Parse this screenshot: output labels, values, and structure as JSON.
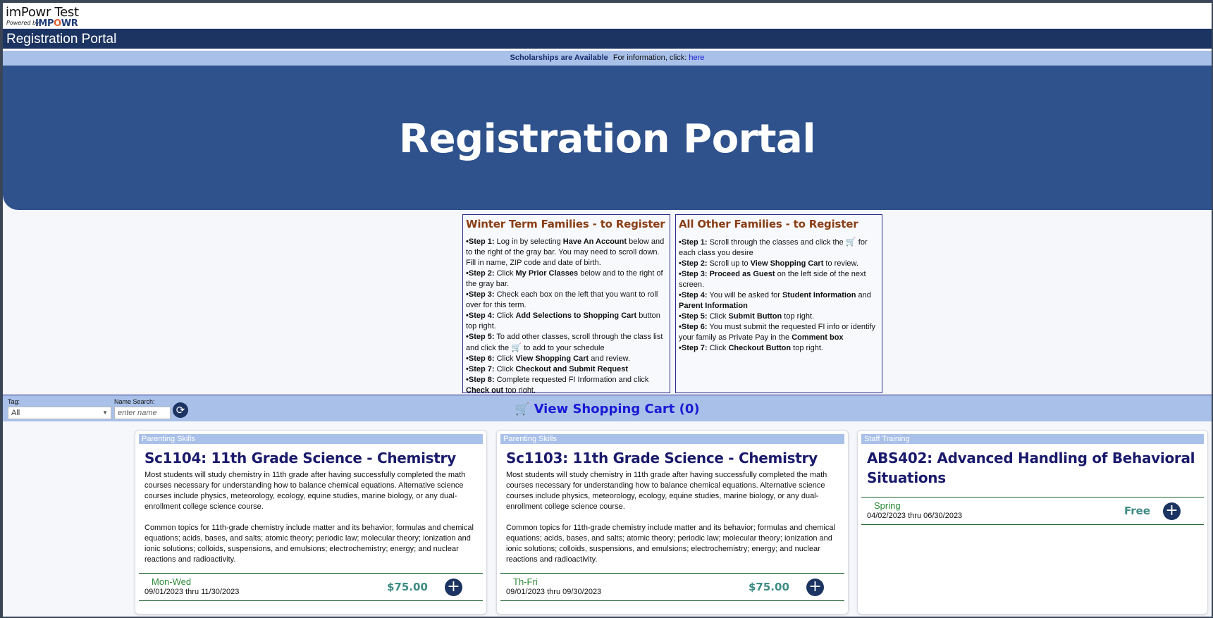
{
  "header": {
    "app_title": "imPowr Test",
    "powered_by": "Powered by",
    "brand_pre": "IMP",
    "brand_o": "O",
    "brand_post": "WR"
  },
  "portal_bar": {
    "title": "Registration Portal"
  },
  "notice": {
    "bold": "Scholarships are Available",
    "text": "For information, click:",
    "link": "here"
  },
  "hero": {
    "title": "Registration Portal"
  },
  "winter": {
    "title": "Winter Term Families - to Register",
    "steps": [
      {
        "label": "•Step 1:",
        "pre": " Log in by selecting ",
        "bold": "Have An Account",
        "post": " below and to the right of the gray bar. You may need to scroll down. Fill in name, ZIP code and date of birth."
      },
      {
        "label": "•Step 2:",
        "pre": " Click ",
        "bold": "My Prior Classes",
        "post": " below and to the right of the gray bar."
      },
      {
        "label": "•Step 3:",
        "pre": " Check each box on the left that you want to roll over for this term.",
        "bold": "",
        "post": ""
      },
      {
        "label": "•Step 4:",
        "pre": " Click ",
        "bold": "Add Selections to Shopping Cart",
        "post": " button top right."
      },
      {
        "label": "•Step 5:",
        "pre": " To add other classes, scroll through the class list and click the ",
        "bold": "",
        "post": " to add to your schedule"
      },
      {
        "label": "•Step 6:",
        "pre": " Click ",
        "bold": "View Shopping Cart",
        "post": " and review."
      },
      {
        "label": "•Step 7:",
        "pre": " Click ",
        "bold": "Checkout and Submit Request",
        "post": ""
      },
      {
        "label": "•Step 8:",
        "pre": " Complete requested FI Information and click ",
        "bold": "Check out",
        "post": " top right."
      }
    ]
  },
  "other": {
    "title": "All Other Families - to Register",
    "steps": [
      {
        "label": "•Step 1:",
        "pre": " Scroll through the classes and click the ",
        "bold": "",
        "post": " for each class you desire"
      },
      {
        "label": "•Step 2:",
        "pre": " Scroll up to ",
        "bold": "View Shopping Cart",
        "post": " to review."
      },
      {
        "label": "•Step 3:",
        "pre": " ",
        "bold": "Proceed as Guest",
        "post": " on the left side of the next screen."
      },
      {
        "label": "•Step 4:",
        "pre": " You will be asked for ",
        "bold": "Student Information",
        "post": " and "
      },
      {
        "label": "•Step 5:",
        "pre": " Click ",
        "bold": "Submit Button",
        "post": " top right."
      },
      {
        "label": "•Step 6:",
        "pre": " You must submit the requested FI info or identify your family as Private Pay in the ",
        "bold": "Comment box",
        "post": ""
      },
      {
        "label": "•Step 7:",
        "pre": " Click ",
        "bold": "Checkout Button",
        "post": " top right."
      }
    ],
    "step4_bold2": "Parent Information"
  },
  "filters": {
    "tag_label": "Tag:",
    "tag_value": "All",
    "name_label": "Name Search:",
    "name_placeholder": "enter name"
  },
  "cart": {
    "label": "View Shopping Cart (0)"
  },
  "courses": [
    {
      "category": "Parenting Skills",
      "title": "Sc1104: 11th Grade Science - Chemistry",
      "desc1": "Most students will study chemistry in 11th grade after having successfully completed the math courses necessary for understanding how to balance chemical equations. Alternative science courses include physics, meteorology, ecology, equine studies, marine biology, or any dual-enrollment college science course.",
      "desc2": "Common topics for 11th-grade chemistry include matter and its behavior; formulas and chemical equations; acids, bases, and salts; atomic theory; periodic law; molecular theory; ionization and ionic solutions; colloids, suspensions, and emulsions; electrochemistry; energy; and nuclear reactions and radioactivity.",
      "day": "Mon-Wed",
      "dates": "09/01/2023 thru 11/30/2023",
      "price": "$75.00"
    },
    {
      "category": "Parenting Skills",
      "title": "Sc1103: 11th Grade Science - Chemistry",
      "desc1": "Most students will study chemistry in 11th grade after having successfully completed the math courses necessary for understanding how to balance chemical equations. Alternative science courses include physics, meteorology, ecology, equine studies, marine biology, or any dual-enrollment college science course.",
      "desc2": "Common topics for 11th-grade chemistry include matter and its behavior; formulas and chemical equations; acids, bases, and salts; atomic theory; periodic law; molecular theory; ionization and ionic solutions; colloids, suspensions, and emulsions; electrochemistry; energy; and nuclear reactions and radioactivity.",
      "day": "Th-Fri",
      "dates": "09/01/2023 thru 09/30/2023",
      "price": "$75.00"
    },
    {
      "category": "Staff Training",
      "title": "ABS402: Advanced Handling of Behavioral Situations",
      "desc1": "",
      "desc2": "",
      "day": "Spring",
      "dates": "04/02/2023 thru 06/30/2023",
      "price": "Free"
    }
  ],
  "icons": {
    "cart": "shopping-cart-icon",
    "add": "plus-circle-icon",
    "refresh": "refresh-icon"
  },
  "colors": {
    "navy": "#1c3461",
    "hero": "#2f528c",
    "light_blue": "#a9c0e8",
    "heading_brown": "#8a3f16",
    "price_teal": "#3d8c84"
  }
}
